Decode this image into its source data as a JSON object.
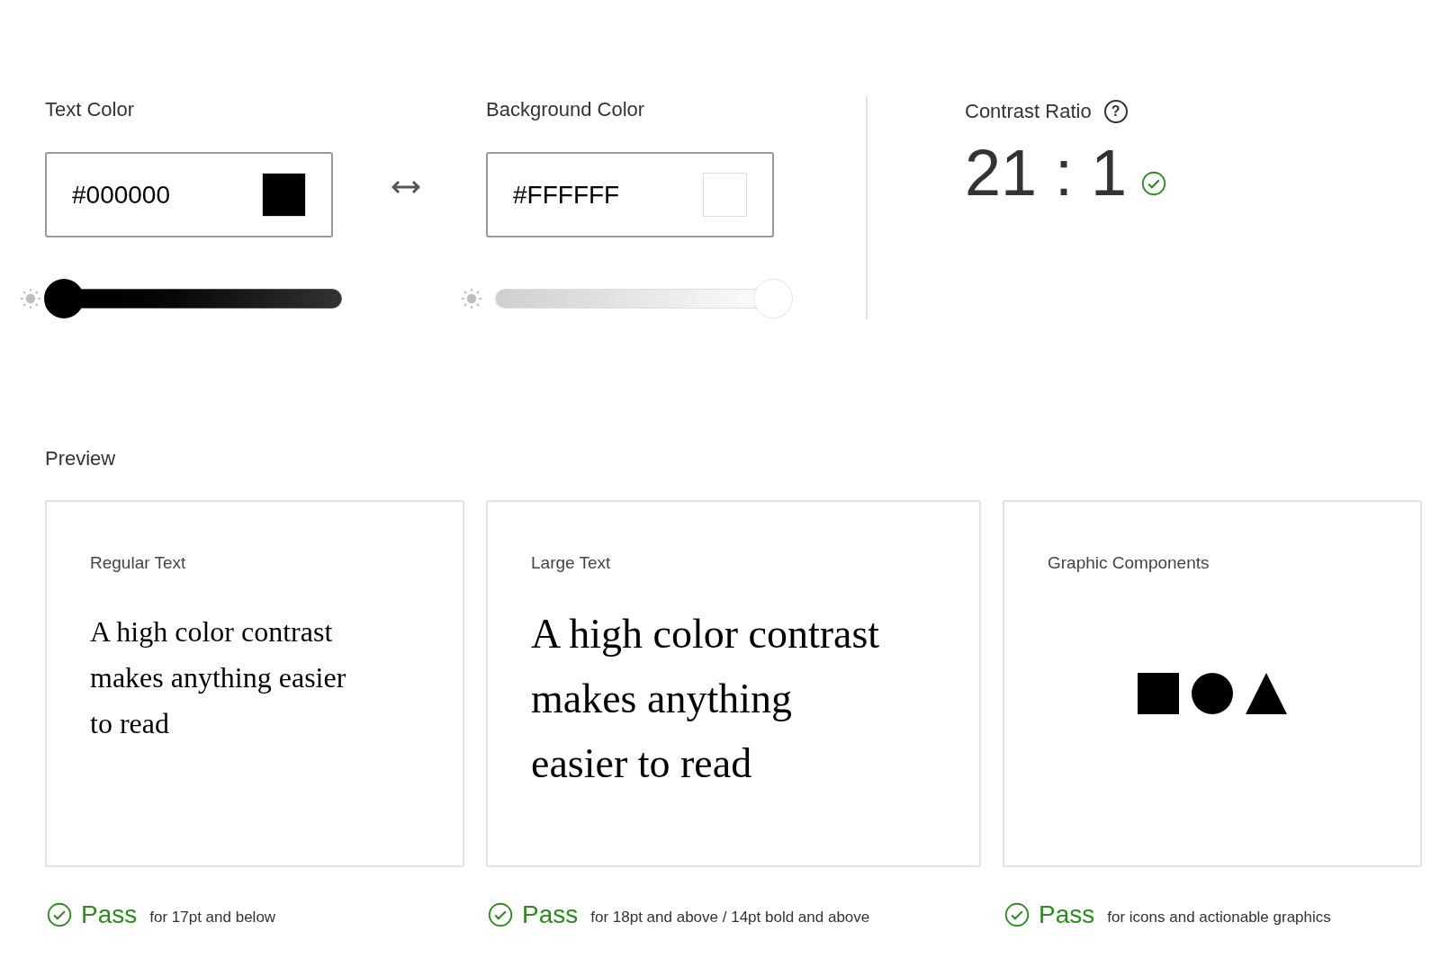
{
  "colors": [
    {
      "label": "Text Color",
      "value": "#000000",
      "color": "#000000",
      "level": 0
    },
    {
      "label": "Background Color",
      "value": "#FFFFFF",
      "color": "#ffffff",
      "level": 1
    }
  ],
  "contrast": {
    "label": "Contrast Ratio",
    "help": "?",
    "value": "21 : 1",
    "passed": true
  },
  "preview": {
    "label": "Preview",
    "cards": [
      {
        "kind": "text",
        "title": "Regular Text",
        "text": "A high color contrast makes anything easier to read",
        "result": {
          "passed": true,
          "label": "Pass",
          "note": "for 17pt and below"
        }
      },
      {
        "kind": "large_text",
        "title": "Large Text",
        "text": "A high color contrast makes anything easier to read",
        "result": {
          "passed": true,
          "label": "Pass",
          "note": "for 18pt and above / 14pt bold and above"
        }
      },
      {
        "kind": "graphics",
        "title": "Graphic Components",
        "result": {
          "passed": true,
          "label": "Pass",
          "note": "for icons and actionable graphics"
        }
      }
    ]
  }
}
